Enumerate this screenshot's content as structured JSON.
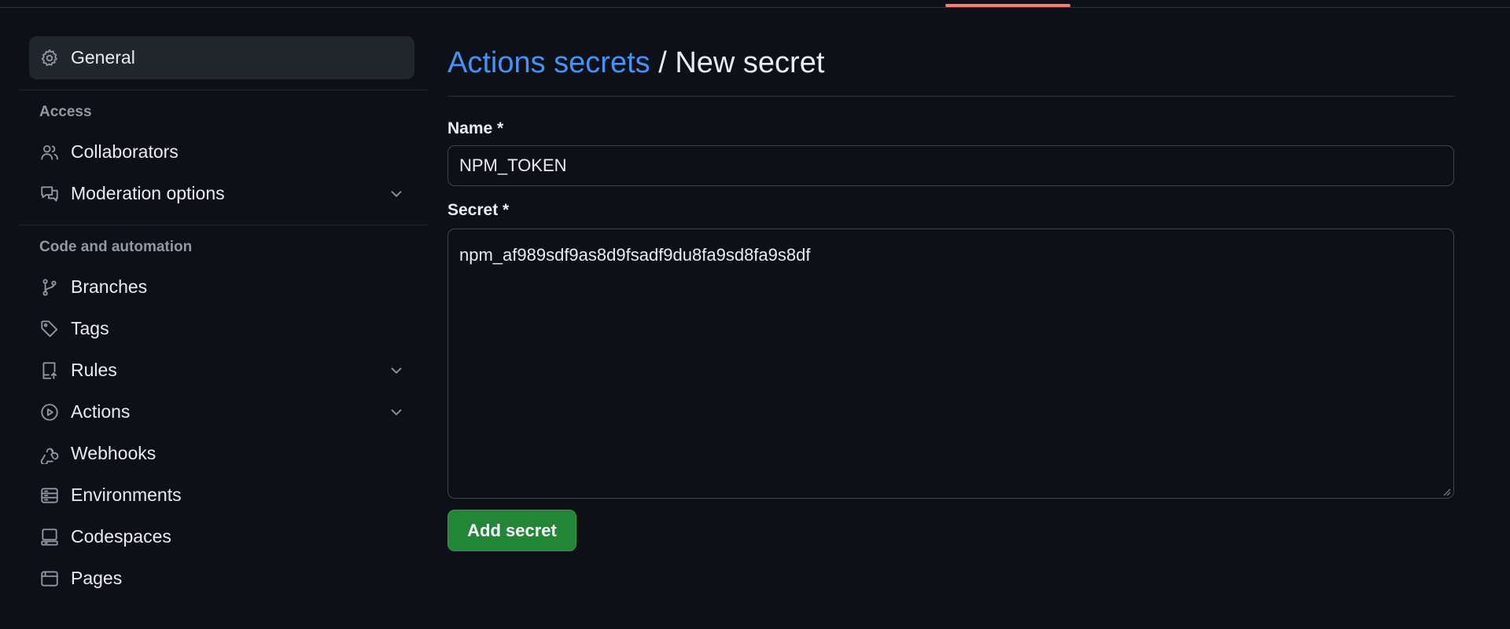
{
  "colors": {
    "background": "#0d1117",
    "accent_link": "#4493f8",
    "primary_button": "#238636",
    "tab_underline": "#f78166"
  },
  "sidebar": {
    "general": {
      "label": "General",
      "icon": "gear-icon"
    },
    "access": {
      "title": "Access",
      "items": [
        {
          "label": "Collaborators",
          "icon": "people-icon",
          "expandable": false
        },
        {
          "label": "Moderation options",
          "icon": "comment-discussion-icon",
          "expandable": true
        }
      ]
    },
    "code_automation": {
      "title": "Code and automation",
      "items": [
        {
          "label": "Branches",
          "icon": "git-branch-icon",
          "expandable": false
        },
        {
          "label": "Tags",
          "icon": "tag-icon",
          "expandable": false
        },
        {
          "label": "Rules",
          "icon": "repo-push-icon",
          "expandable": true
        },
        {
          "label": "Actions",
          "icon": "play-icon",
          "expandable": true
        },
        {
          "label": "Webhooks",
          "icon": "webhook-icon",
          "expandable": false
        },
        {
          "label": "Environments",
          "icon": "server-icon",
          "expandable": false
        },
        {
          "label": "Codespaces",
          "icon": "codespaces-icon",
          "expandable": false
        },
        {
          "label": "Pages",
          "icon": "browser-icon",
          "expandable": false
        }
      ]
    }
  },
  "main": {
    "breadcrumb": {
      "link": "Actions secrets",
      "separator": " / ",
      "current": "New secret"
    },
    "form": {
      "name_label": "Name *",
      "name_value": "NPM_TOKEN",
      "secret_label": "Secret *",
      "secret_value": "npm_af989sdf9as8d9fsadf9du8fa9sd8fa9s8df",
      "submit_label": "Add secret"
    }
  }
}
